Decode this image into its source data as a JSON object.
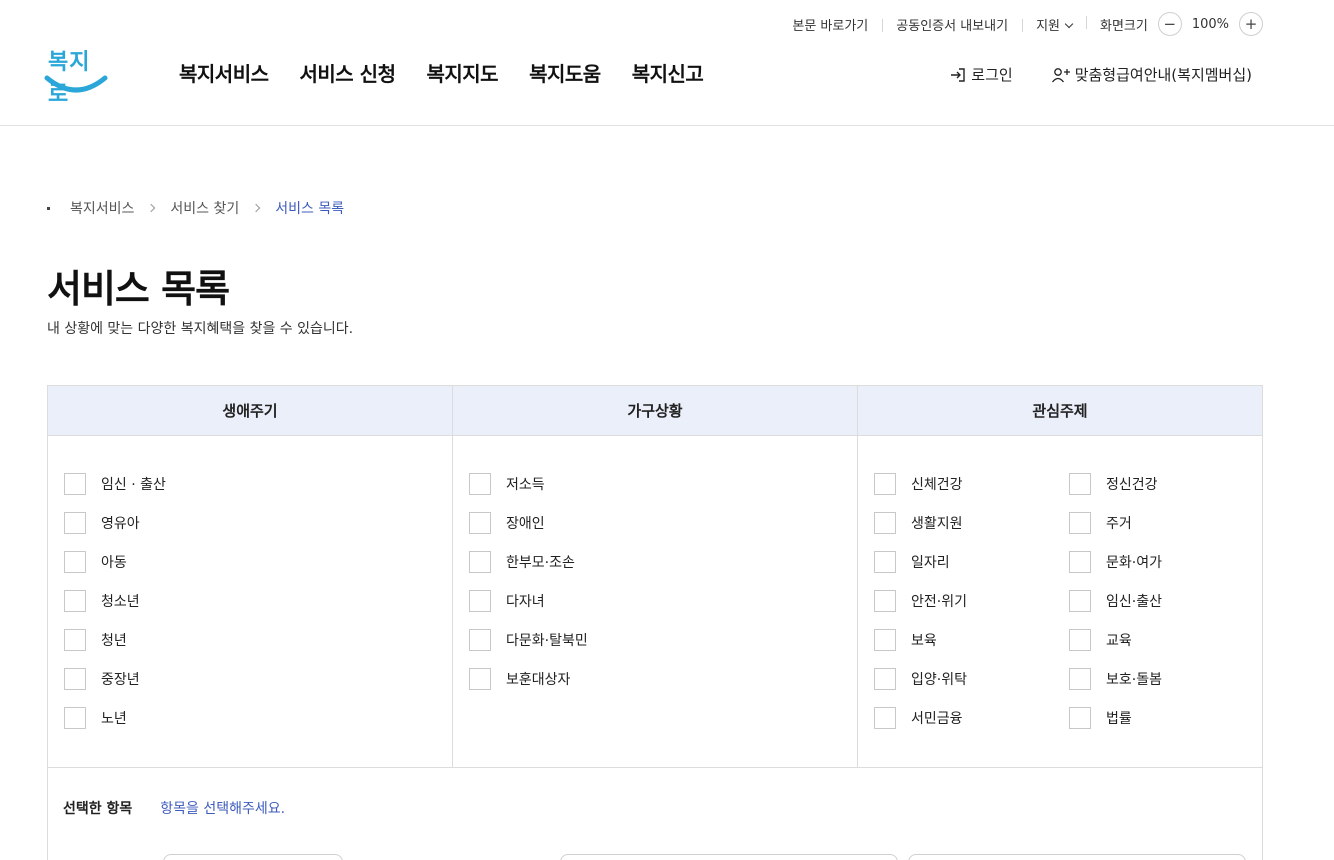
{
  "util": {
    "skip": "본문 바로가기",
    "cert": "공동인증서 내보내기",
    "support": "지원",
    "zoom_label": "화면크기",
    "zoom_minus": "−",
    "zoom_value": "100%",
    "zoom_plus": "+"
  },
  "logo": {
    "text": "복지로"
  },
  "gnb": [
    "복지서비스",
    "서비스 신청",
    "복지지도",
    "복지도움",
    "복지신고"
  ],
  "top_right": {
    "login": "로그인",
    "membership": "맞춤형급여안내(복지멤버십)"
  },
  "breadcrumb": [
    "복지서비스",
    "서비스 찾기",
    "서비스 목록"
  ],
  "page": {
    "title": "서비스 목록",
    "desc": "내 상황에 맞는 다양한 복지혜택을 찾을 수 있습니다."
  },
  "filter": {
    "headers": [
      "생애주기",
      "가구상황",
      "관심주제"
    ],
    "lifecycle": [
      "임신 · 출산",
      "영유아",
      "아동",
      "청소년",
      "청년",
      "중장년",
      "노년"
    ],
    "household": [
      "저소득",
      "장애인",
      "한부모·조손",
      "다자녀",
      "다문화·탈북민",
      "보훈대상자"
    ],
    "topics_left": [
      "신체건강",
      "생활지원",
      "일자리",
      "안전·위기",
      "보육",
      "입양·위탁",
      "서민금융"
    ],
    "topics_right": [
      "정신건강",
      "주거",
      "문화·여가",
      "임신·출산",
      "교육",
      "보호·돌봄",
      "법률"
    ],
    "selected_label": "선택한 항목",
    "selected_value": "항목을 선택해주세요."
  },
  "colors": {
    "accent": "#3d5bbd",
    "header_bg": "#ebeffa",
    "logo": "#2aa6d8"
  }
}
